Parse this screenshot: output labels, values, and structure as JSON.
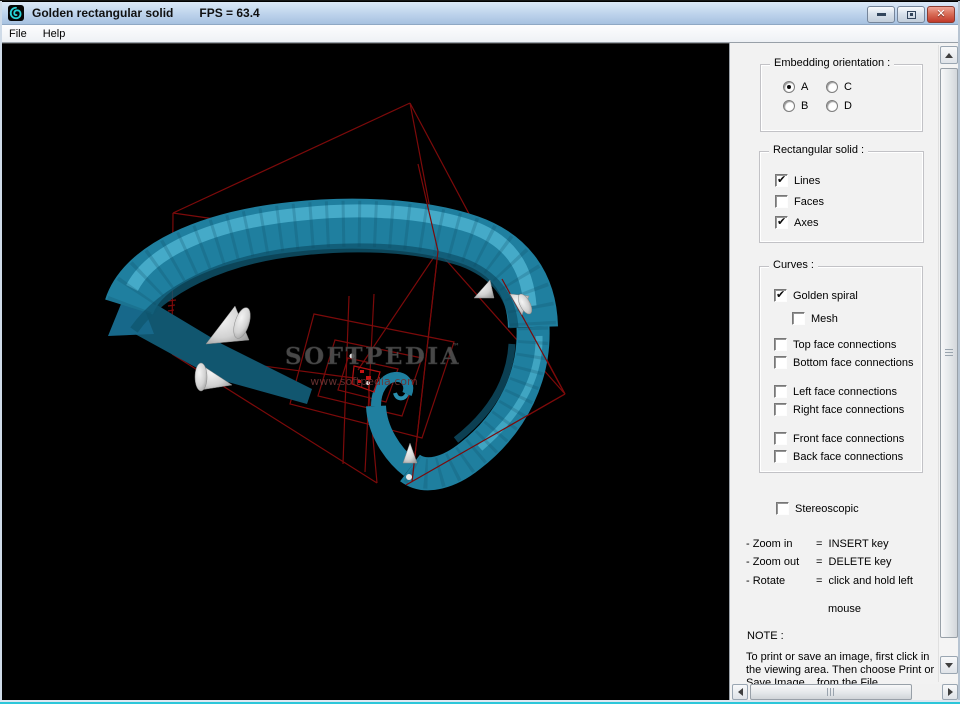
{
  "window": {
    "title": "Golden rectangular solid",
    "fps": "FPS = 63.4"
  },
  "menu": {
    "items": [
      {
        "label": "File"
      },
      {
        "label": "Help"
      }
    ]
  },
  "viewport": {
    "watermark": {
      "brand": "SOFTPEDIA",
      "tm": "™",
      "url": "www.softpedia.com"
    }
  },
  "panel": {
    "orientation_group": {
      "title": "Embedding orientation :",
      "options": [
        {
          "label": "A",
          "checked": true
        },
        {
          "label": "B",
          "checked": false
        },
        {
          "label": "C",
          "checked": false
        },
        {
          "label": "D",
          "checked": false
        }
      ]
    },
    "solid_group": {
      "title": "Rectangular solid :",
      "options": [
        {
          "label": "Lines",
          "checked": true
        },
        {
          "label": "Faces",
          "checked": false
        },
        {
          "label": "Axes",
          "checked": true
        }
      ]
    },
    "curves_group": {
      "title": "Curves :",
      "options": [
        {
          "label": "Golden spiral",
          "checked": true
        },
        {
          "label": "Mesh",
          "checked": false
        },
        {
          "label": "Top face connections",
          "checked": false
        },
        {
          "label": "Bottom face connections",
          "checked": false
        },
        {
          "label": "Left face connections",
          "checked": false
        },
        {
          "label": "Right face connections",
          "checked": false
        },
        {
          "label": "Front face connections",
          "checked": false
        },
        {
          "label": "Back face connections",
          "checked": false
        }
      ]
    },
    "stereoscopic": {
      "label": "Stereoscopic",
      "checked": false
    },
    "shortcuts": [
      {
        "action": "- Zoom in",
        "key": "=  INSERT key"
      },
      {
        "action": "- Zoom out",
        "key": "=  DELETE key"
      },
      {
        "action": "- Rotate",
        "key": "=  click and hold left"
      }
    ],
    "shortcuts_cont": "mouse",
    "note": {
      "title": "NOTE :",
      "lines": [
        "To print or save an image, first click in",
        "the viewing area.  Then choose Print or",
        "Save Image...  from the File"
      ]
    }
  },
  "colors": {
    "spiral": "#1f7f9f",
    "spiral_highlight": "#4cb2cf",
    "spiral_shadow": "#0f566f",
    "wireframe": "#7c0a0a",
    "wireframe_bright": "#c41414",
    "cone": "#d6d6d6",
    "viewport_background": "#000000",
    "titlebar_accent": "#bdd3ec",
    "bottom_edge_accent": "#2cc6d9"
  }
}
